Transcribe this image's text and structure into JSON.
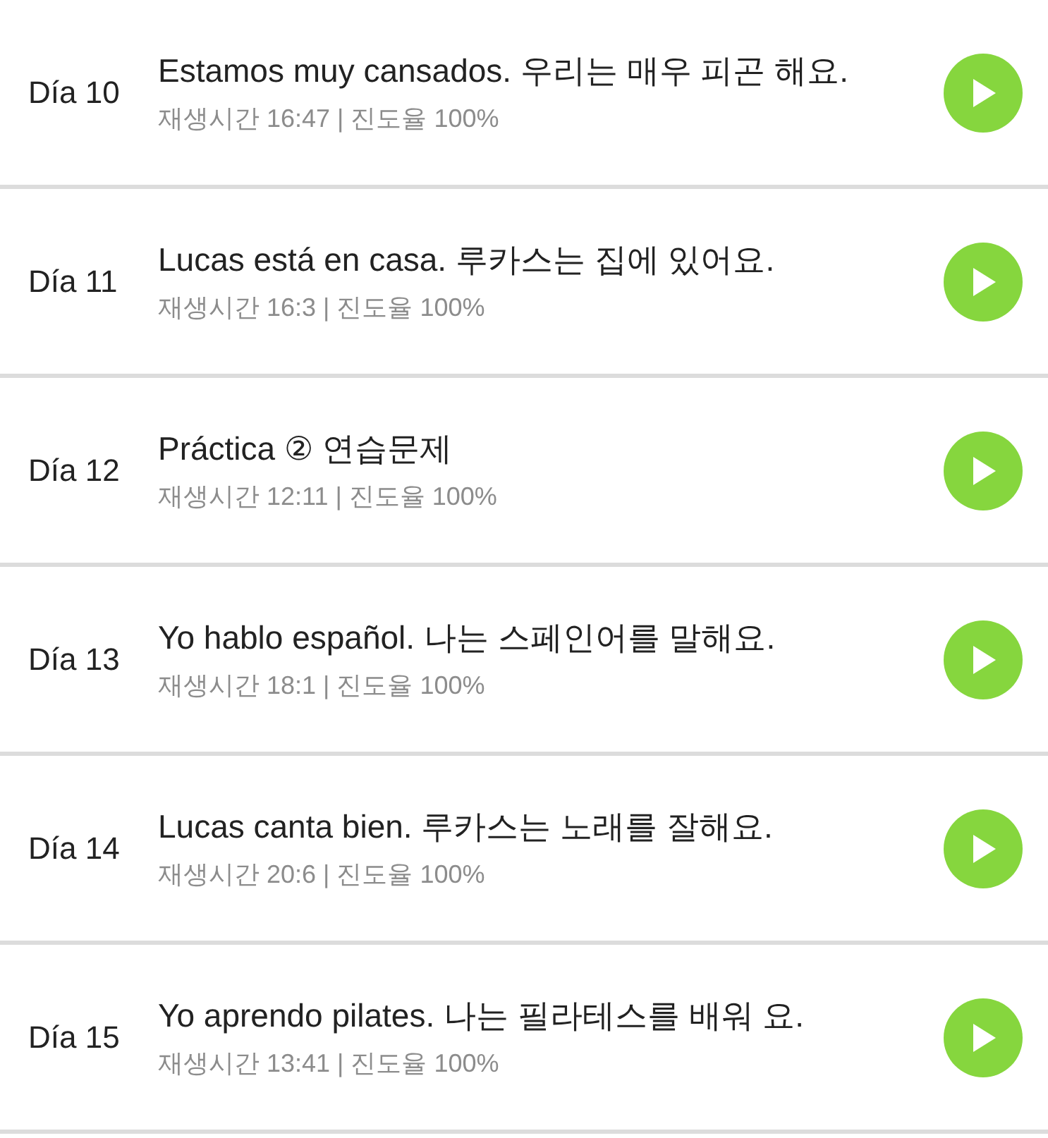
{
  "lessons": [
    {
      "day": "Día 10",
      "title": "Estamos muy cansados. 우리는 매우 피곤 해요.",
      "info": "재생시간 16:47 | 진도율 100%"
    },
    {
      "day": "Día 11",
      "title": "Lucas está en casa. 루카스는 집에 있어요.",
      "info": "재생시간 16:3 | 진도율 100%"
    },
    {
      "day": "Día 12",
      "title": "Práctica ② 연습문제",
      "info": "재생시간 12:11 | 진도율 100%"
    },
    {
      "day": "Día 13",
      "title": "Yo hablo español. 나는 스페인어를 말해요.",
      "info": "재생시간 18:1 | 진도율 100%"
    },
    {
      "day": "Día 14",
      "title": "Lucas canta bien. 루카스는 노래를 잘해요.",
      "info": "재생시간 20:6 | 진도율 100%"
    },
    {
      "day": "Día 15",
      "title": "Yo aprendo pilates. 나는 필라테스를 배워 요.",
      "info": "재생시간 13:41 | 진도율 100%"
    }
  ]
}
